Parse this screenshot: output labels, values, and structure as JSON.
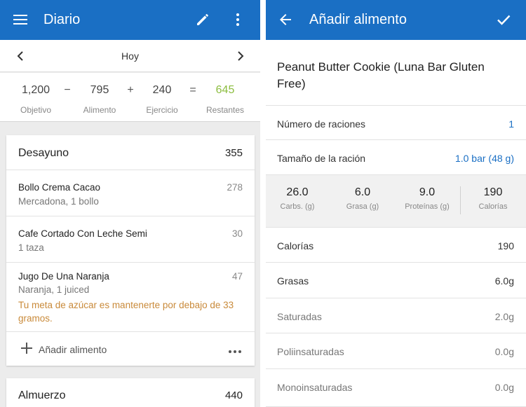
{
  "left": {
    "appbar": {
      "title": "Diario"
    },
    "date": {
      "label": "Hoy"
    },
    "summary": {
      "goal": "1,200",
      "goal_label": "Objetivo",
      "minus": "−",
      "food": "795",
      "food_label": "Alimento",
      "plus": "+",
      "exercise": "240",
      "exercise_label": "Ejercicio",
      "equals": "=",
      "remaining": "645",
      "remaining_label": "Restantes"
    },
    "breakfast": {
      "name": "Desayuno",
      "calories": "355",
      "entries": [
        {
          "name": "Bollo Crema Cacao",
          "detail": "Mercadona, 1 bollo",
          "calories": "278"
        },
        {
          "name": "Cafe Cortado Con Leche Semi",
          "detail": "1 taza",
          "calories": "30"
        },
        {
          "name": "Jugo De Una Naranja",
          "detail": "Naranja, 1 juiced",
          "calories": "47",
          "warning": "Tu meta de azúcar es mantenerte por debajo de 33 gramos."
        }
      ],
      "add_label": "Añadir alimento"
    },
    "lunch": {
      "name": "Almuerzo",
      "calories": "440"
    }
  },
  "right": {
    "appbar": {
      "title": "Añadir alimento"
    },
    "food_name": "Peanut Butter Cookie (Luna Bar Gluten Free)",
    "servings": {
      "label": "Número de raciones",
      "value": "1"
    },
    "serving_size": {
      "label": "Tamaño de la ración",
      "value": "1.0 bar (48 g)"
    },
    "macros": [
      {
        "value": "26.0",
        "label": "Carbs. (g)"
      },
      {
        "value": "6.0",
        "label": "Grasa (g)"
      },
      {
        "value": "9.0",
        "label": "Proteínas (g)"
      },
      {
        "value": "190",
        "label": "Calorías"
      }
    ],
    "nutrients": [
      {
        "label": "Calorías",
        "value": "190"
      },
      {
        "label": "Grasas",
        "value": "6.0g"
      },
      {
        "label": "Saturadas",
        "value": "2.0g"
      },
      {
        "label": "Poliinsaturadas",
        "value": "0.0g"
      },
      {
        "label": "Monoinsaturadas",
        "value": "0.0g"
      }
    ]
  },
  "colors": {
    "primary": "#1a6fc4",
    "remaining_green": "#8cbd3f",
    "warning": "#c98a3a"
  }
}
